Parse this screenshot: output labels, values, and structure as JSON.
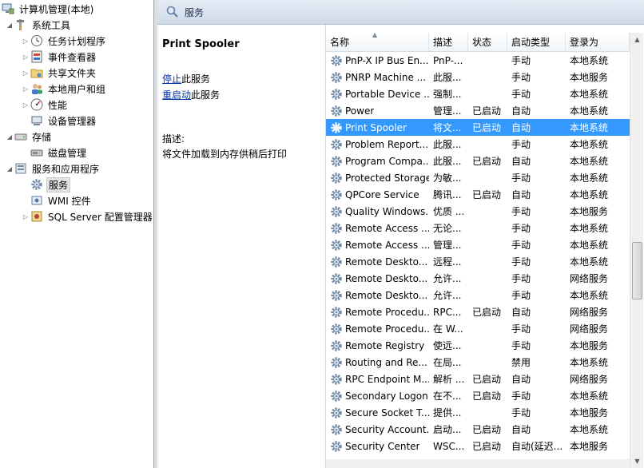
{
  "tree": {
    "items": [
      {
        "label": "计算机管理(本地)",
        "icon": "computer-management-icon",
        "arrow": ""
      },
      {
        "label": "系统工具",
        "icon": "system-tools-icon",
        "arrow": "▲"
      },
      {
        "label": "任务计划程序",
        "icon": "task-scheduler-icon",
        "arrow": "▷"
      },
      {
        "label": "事件查看器",
        "icon": "event-viewer-icon",
        "arrow": "▷"
      },
      {
        "label": "共享文件夹",
        "icon": "shared-folders-icon",
        "arrow": "▷"
      },
      {
        "label": "本地用户和组",
        "icon": "local-users-icon",
        "arrow": "▷"
      },
      {
        "label": "性能",
        "icon": "performance-icon",
        "arrow": "▷"
      },
      {
        "label": "设备管理器",
        "icon": "device-manager-icon",
        "arrow": ""
      },
      {
        "label": "存储",
        "icon": "storage-icon",
        "arrow": "▲"
      },
      {
        "label": "磁盘管理",
        "icon": "disk-management-icon",
        "arrow": ""
      },
      {
        "label": "服务和应用程序",
        "icon": "services-apps-icon",
        "arrow": "▲"
      },
      {
        "label": "服务",
        "icon": "services-gear-icon",
        "arrow": "",
        "selected": true
      },
      {
        "label": "WMI 控件",
        "icon": "wmi-control-icon",
        "arrow": ""
      },
      {
        "label": "SQL Server 配置管理器",
        "icon": "sql-server-config-icon",
        "arrow": "▷"
      }
    ]
  },
  "header": {
    "title": "服务"
  },
  "extended": {
    "service_name": "Print Spooler",
    "stop_link": "停止",
    "stop_suffix": "此服务",
    "restart_link": "重启动",
    "restart_suffix": "此服务",
    "desc_label": "描述:",
    "desc_text": "将文件加载到内存供稍后打印"
  },
  "columns": {
    "name": "名称",
    "desc": "描述",
    "status": "状态",
    "startup": "启动类型",
    "logon": "登录为"
  },
  "services": [
    {
      "name": "PnP-X IP Bus En...",
      "desc": "PnP-...",
      "status": "",
      "startup": "手动",
      "logon": "本地系统"
    },
    {
      "name": "PNRP Machine ...",
      "desc": "此服...",
      "status": "",
      "startup": "手动",
      "logon": "本地服务"
    },
    {
      "name": "Portable Device ...",
      "desc": "强制...",
      "status": "",
      "startup": "手动",
      "logon": "本地系统"
    },
    {
      "name": "Power",
      "desc": "管理...",
      "status": "已启动",
      "startup": "自动",
      "logon": "本地系统"
    },
    {
      "name": "Print Spooler",
      "desc": "将文...",
      "status": "已启动",
      "startup": "自动",
      "logon": "本地系统",
      "selected": true
    },
    {
      "name": "Problem Report...",
      "desc": "此服...",
      "status": "",
      "startup": "手动",
      "logon": "本地系统"
    },
    {
      "name": "Program Compa...",
      "desc": "此服...",
      "status": "已启动",
      "startup": "自动",
      "logon": "本地系统"
    },
    {
      "name": "Protected Storage",
      "desc": "为敏...",
      "status": "",
      "startup": "手动",
      "logon": "本地系统"
    },
    {
      "name": "QPCore Service",
      "desc": "腾讯...",
      "status": "已启动",
      "startup": "自动",
      "logon": "本地系统"
    },
    {
      "name": "Quality Windows...",
      "desc": "优质 ...",
      "status": "",
      "startup": "手动",
      "logon": "本地服务"
    },
    {
      "name": "Remote Access ...",
      "desc": "无论...",
      "status": "",
      "startup": "手动",
      "logon": "本地系统"
    },
    {
      "name": "Remote Access ...",
      "desc": "管理...",
      "status": "",
      "startup": "手动",
      "logon": "本地系统"
    },
    {
      "name": "Remote Deskto...",
      "desc": "远程...",
      "status": "",
      "startup": "手动",
      "logon": "本地系统"
    },
    {
      "name": "Remote Deskto...",
      "desc": "允许...",
      "status": "",
      "startup": "手动",
      "logon": "网络服务"
    },
    {
      "name": "Remote Deskto...",
      "desc": "允许...",
      "status": "",
      "startup": "手动",
      "logon": "本地系统"
    },
    {
      "name": "Remote Procedu...",
      "desc": "RPC...",
      "status": "已启动",
      "startup": "自动",
      "logon": "网络服务"
    },
    {
      "name": "Remote Procedu...",
      "desc": "在 W...",
      "status": "",
      "startup": "手动",
      "logon": "网络服务"
    },
    {
      "name": "Remote Registry",
      "desc": "使远...",
      "status": "",
      "startup": "手动",
      "logon": "本地服务"
    },
    {
      "name": "Routing and Re...",
      "desc": "在局...",
      "status": "",
      "startup": "禁用",
      "logon": "本地系统"
    },
    {
      "name": "RPC Endpoint M...",
      "desc": "解析 ...",
      "status": "已启动",
      "startup": "自动",
      "logon": "网络服务"
    },
    {
      "name": "Secondary Logon",
      "desc": "在不...",
      "status": "已启动",
      "startup": "手动",
      "logon": "本地系统"
    },
    {
      "name": "Secure Socket T...",
      "desc": "提供...",
      "status": "",
      "startup": "手动",
      "logon": "本地服务"
    },
    {
      "name": "Security Account...",
      "desc": "启动...",
      "status": "已启动",
      "startup": "自动",
      "logon": "本地系统"
    },
    {
      "name": "Security Center",
      "desc": "WSC...",
      "status": "已启动",
      "startup": "自动(延迟...",
      "logon": "本地服务"
    }
  ],
  "colors": {
    "selection": "#3399ff",
    "link": "#0033aa"
  }
}
